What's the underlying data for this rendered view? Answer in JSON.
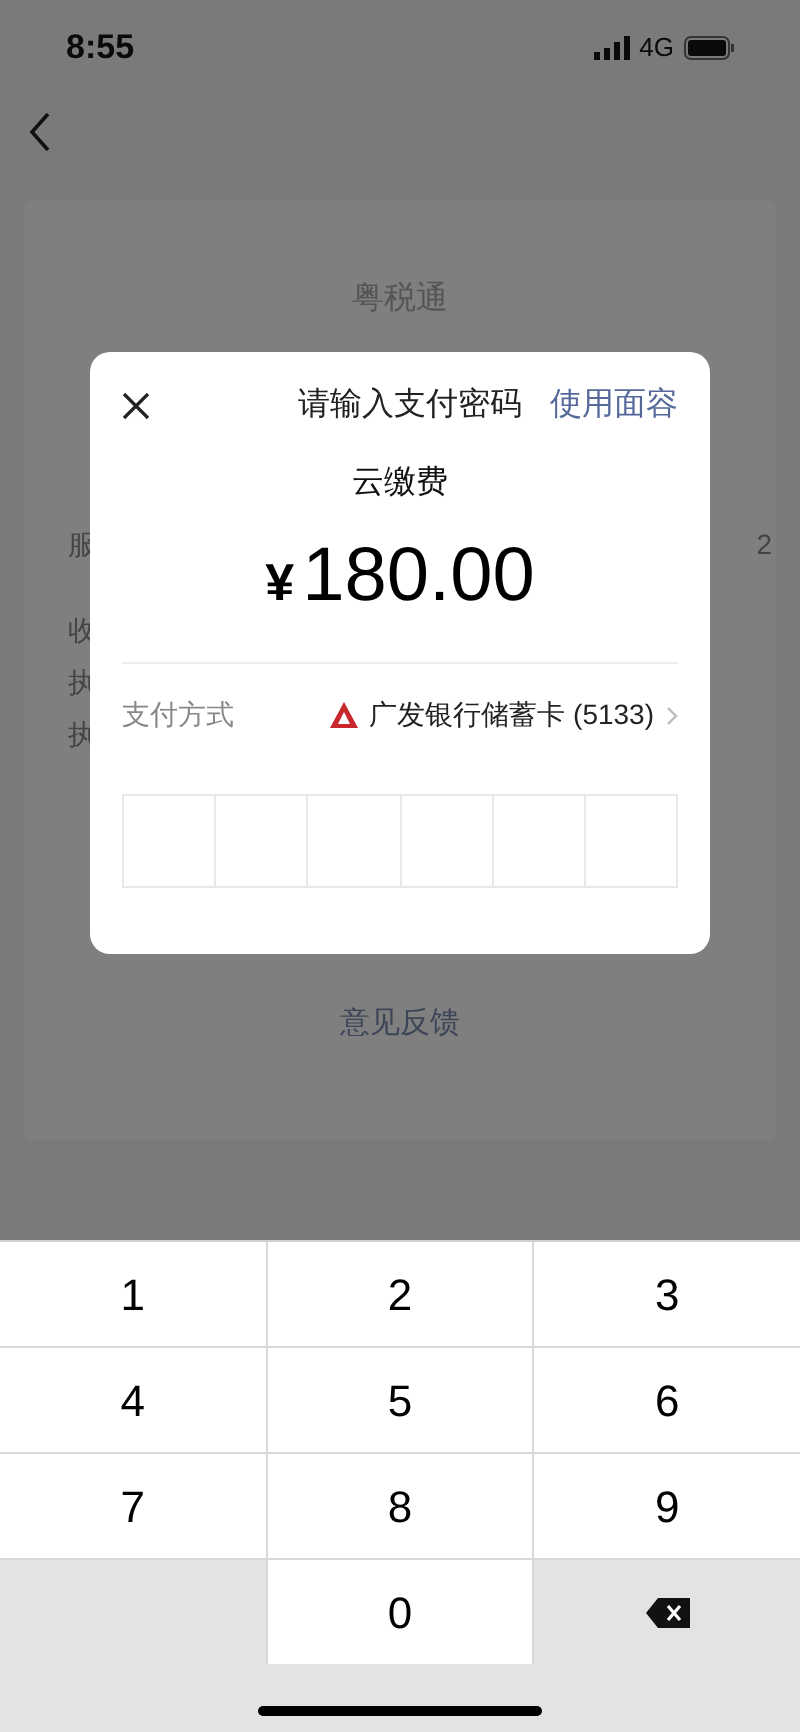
{
  "status_bar": {
    "time": "8:55",
    "network": "4G"
  },
  "background": {
    "merchant": "粤税通",
    "row_labels": [
      "服",
      "收",
      "执",
      "执"
    ],
    "row_value": "2",
    "feedback_link": "意见反馈"
  },
  "dialog": {
    "title": "请输入支付密码",
    "face_link": "使用面容",
    "payee": "云缴费",
    "currency": "¥",
    "amount": "180.00",
    "payment_method_label": "支付方式",
    "payment_method": "广发银行储蓄卡 (5133)",
    "pin_boxes": [
      {
        "filled": false
      },
      {
        "filled": false
      },
      {
        "filled": false
      },
      {
        "filled": false
      },
      {
        "filled": false
      },
      {
        "filled": false
      }
    ]
  },
  "keypad": [
    {
      "kind": "digit",
      "label": "1"
    },
    {
      "kind": "digit",
      "label": "2"
    },
    {
      "kind": "digit",
      "label": "3"
    },
    {
      "kind": "digit",
      "label": "4"
    },
    {
      "kind": "digit",
      "label": "5"
    },
    {
      "kind": "digit",
      "label": "6"
    },
    {
      "kind": "digit",
      "label": "7"
    },
    {
      "kind": "digit",
      "label": "8"
    },
    {
      "kind": "digit",
      "label": "9"
    },
    {
      "kind": "blank"
    },
    {
      "kind": "digit",
      "label": "0"
    },
    {
      "kind": "delete"
    }
  ]
}
